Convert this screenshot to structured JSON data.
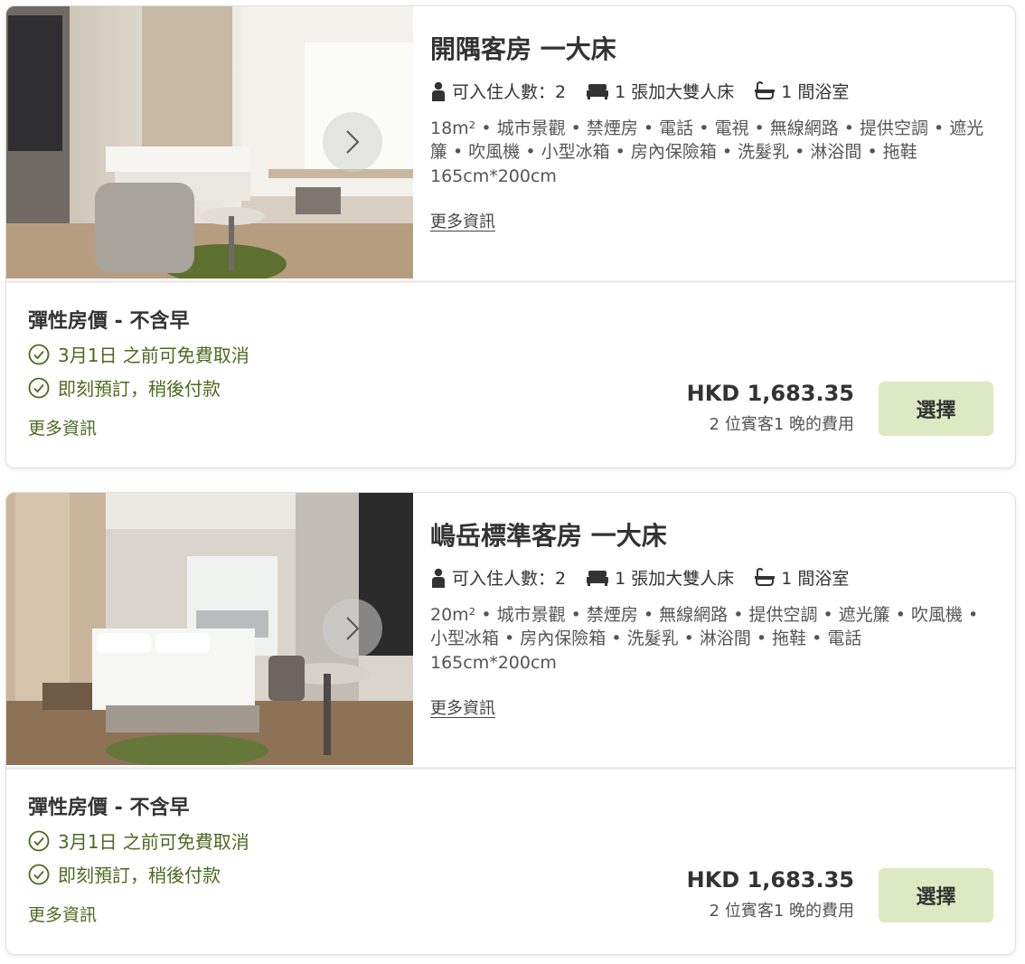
{
  "rooms": [
    {
      "title": "開隅客房 一大床",
      "occupancy": "可入住人數：2",
      "bed": "1 張加大雙人床",
      "bath": "1 間浴室",
      "amenities": "18m² • 城市景觀 • 禁煙房 • 電話 • 電視 • 無線網路 • 提供空調 • 遮光簾 • 吹風機 • 小型冰箱 • 房內保險箱 • 洗髮乳 • 淋浴間 • 拖鞋",
      "bed_size": "165cm*200cm",
      "more_info": "更多資訊",
      "rate": {
        "name": "彈性房價 - 不含早",
        "perks": [
          "3月1日 之前可免費取消",
          "即刻預訂，稍後付款"
        ],
        "more_info": "更多資訊",
        "price": "HKD 1,683.35",
        "price_note": "2 位賓客1 晚的費用",
        "select_label": "選擇"
      }
    },
    {
      "title": "嶋岳標準客房 一大床",
      "occupancy": "可入住人數：2",
      "bed": "1 張加大雙人床",
      "bath": "1 間浴室",
      "amenities": "20m² • 城市景觀 • 禁煙房 • 無線網路 • 提供空調 • 遮光簾 • 吹風機 • 小型冰箱 • 房內保險箱 • 洗髮乳 • 淋浴間 • 拖鞋 • 電話",
      "bed_size": "165cm*200cm",
      "more_info": "更多資訊",
      "rate": {
        "name": "彈性房價 - 不含早",
        "perks": [
          "3月1日 之前可免費取消",
          "即刻預訂，稍後付款"
        ],
        "more_info": "更多資訊",
        "price": "HKD 1,683.35",
        "price_note": "2 位賓客1 晚的費用",
        "select_label": "選擇"
      }
    }
  ],
  "icons": {
    "occupancy": "person-icon",
    "bed": "bed-icon",
    "bath": "bathtub-icon",
    "perk": "check-circle-icon",
    "next": "chevron-right-icon"
  },
  "colors": {
    "accent_green": "#4a6a1e",
    "button_bg": "#dde9c2",
    "border": "#dedede"
  }
}
